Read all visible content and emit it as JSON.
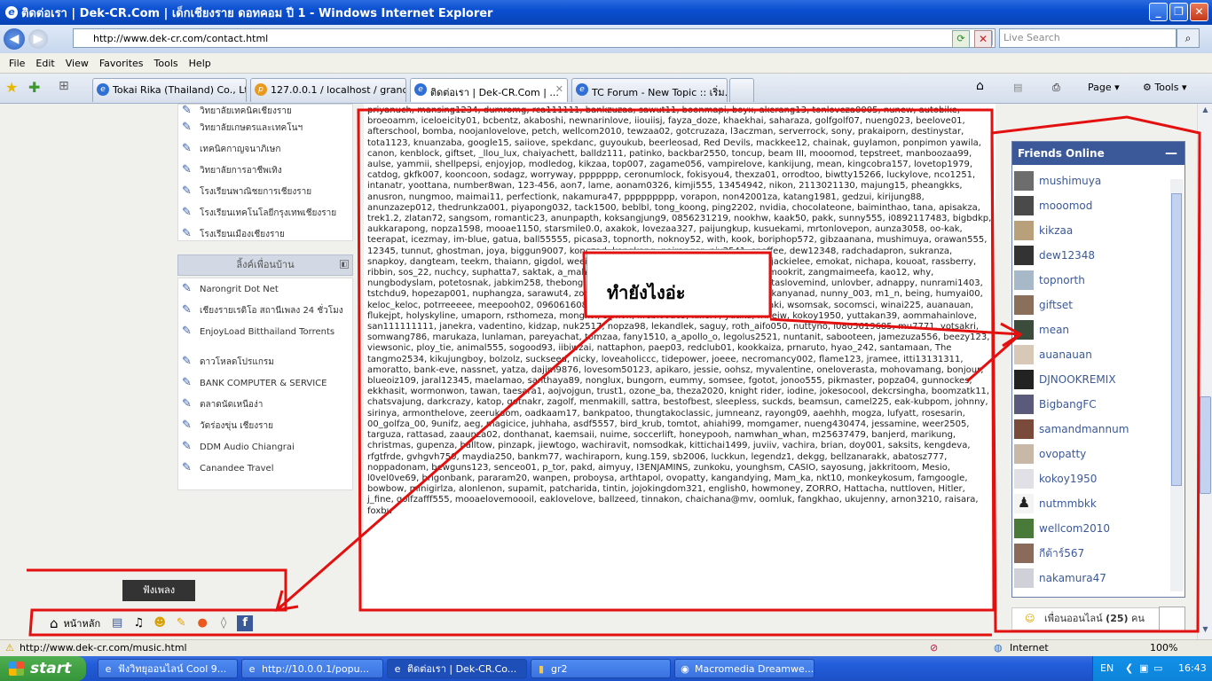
{
  "window": {
    "title": "ติดต่อเรา | Dek-CR.Com | เด็กเชียงราย ดอทคอม ปี 1 - Windows Internet Explorer"
  },
  "address": {
    "url": "http://www.dek-cr.com/contact.html",
    "search_placeholder": "Live Search"
  },
  "menu": [
    "File",
    "Edit",
    "View",
    "Favorites",
    "Tools",
    "Help"
  ],
  "tabs": [
    {
      "label": "Tokai Rika (Thailand) Co., Lt..."
    },
    {
      "label": "127.0.0.1 / localhost / grand..."
    },
    {
      "label": "ติดต่อเรา | Dek-CR.Com | ...",
      "active": true
    },
    {
      "label": "TC Forum - New Topic :: เริ่ม..."
    }
  ],
  "commands": {
    "page": "Page",
    "tools": "Tools"
  },
  "sidebar_top": [
    "วิทยาลัยเทคนิคเชียงราย",
    "วิทยาลัยเกษตรและเทคโนฯ",
    "เทคนิคกาญจนาภิเษก",
    "วิทยาลัยการอาชีพเทิง",
    "โรงเรียนพาณิชยการเชียงราย",
    "โรงเรียนเทคโนโลยีกรุงเทพเชียงราย",
    "โรงเรียนเมืองเชียงราย"
  ],
  "sidebar_heading": "ลิ้งค์เพื่อนบ้าน",
  "sidebar_links": [
    "Narongrit Dot Net",
    "เชียงรายเรดิโอ สถานีเพลง 24 ชั่วโมง",
    "EnjoyLoad Bitthailand Torrents",
    "ดาวโหลดโปรแกรม",
    "BANK COMPUTER & SERVICE",
    "ตลาดนัดเหนือง่า",
    "วัดร่องขุ่น เชียงราย",
    "DDM Audio Chiangrai",
    "Canandee Travel"
  ],
  "main_text": "priyanuch, mansing1234, dumromg, rca111111, bankzuzaa, sawut11, boonmapi, boyx, akerang13, tonloveza0005, nunew, autobike, broeoamm, iceloeicity01, bcbentz, akaboshi, newnarinlove, iiouiisj, fayza_doze, khaekhai, saharaza, golfgolf07, nueng023, beelove01, afterschool, bomba, noojanlovelove, petch, wellcom2010, tewzaa02, gotcruzaza, l3aczman, serverrock, sony, prakaiporn, destinystar, tota1123, knuanzaba, google15, saiiove, spekdanc, guyoukub, beerleosad, Red Devils, mackkee12, chainak, guylamon, ponpimon yawila, canon, kenblock, giftset, _llou_lux, chaiyachett, balldz111, patinko, backbar2550, toncup, beam III, mooomod, tepstreet, manboozaa99, aulse, yammii, shellpepsi, enjoyjop, modledog, kikzaa, top007, zagame056, vampirelove, kankijung, mean, kingcobra157, lovetop1979, catdog, gkfk007, kooncoon, sodagz, worryway, ppppppp, ceronumlock, fokisyou4, thexza01, orrodtoo, biwtty15266, luckylove, nco1251, intanatr, yoottana, number8wan, 123-456, aon7, lame, aonam0326, kimji555, 13454942, nikon, 2113021130, majung15, pheangkks, anusron, nungmoo, maimai11, perfectionk, nakamura47, ppppppppp, vorapon, non42001za, katang1981, gedzui, kirijung88, anunzazep012, thedrunkza001, piyapong032, tack1500, beblbl, tong_koong, ping2202, nvidia, chocolateone, baiminthao, tana, apisakza, trek1.2, zlatan72, sangsom, romantic23, anunpapth, koksangjung9, 0856231219, nookhw, kaak50, pakk, sunny555, i0892117483, bigbdkp, aukkarapong, nopza1598, mooae1150, starsmile0.0, axakok, lovezaa327, paijungkup, kusuekami, mrtonlovepon, aunza3058, oo-kak, teerapat, icezmay, im-blue, gatua, ball55555, picasa3, topnorth, noknoy52, with, kook, boriphop572, gibzaanana, mushimuya, orawan555, 12345, tunnut, ghostman, joya, biggun9007, kongzad, kongkong, nairanger, niy2541, snoffee, dew12348, radchadapron, sukranza, snapkoy, dangteam, teekm, thaiann, gigdol, weeix, boydmp, jame9090, crazie001, tap12, jackielee, emokat, nichapa, kouoat, rassberry, ribbin, sos_22, nuchcy, suphatta7, saktak, a_mahome, chamnan, bantiu, pool, tagyam01, mookrit, zangmaimeefa, kao12, why, nungbodyslam, potetosnak, jabkim258, thebong, beesandee, sodato, babytai69, namded, taslovemind, unlovber, adnappy, nunrami1403, tstchdu9, hopezap001, nuphangza, sarawut4, zombie, pt7990023, laslaly22, daveza5008, kanyanad, nunny_003, m1_n, being, humyai00, keloc_keloc, potrreeeee, meepooh02, 096061608, pou ka, qbic, thebat12561, finch, karudaki, wsomsak, socomsci, winai225, auanauan, flukejpt, holyskyline, umaporn, rsthomeza, mongkol, s_mon, lifebloodc3, killer7, yutika, mheiw, kokoy1950, yuttakan39, aommahainlove, san111111111, janekra, vadentino, kidzap, nuk2517, nopza98, lekandlek, saguy, roth_aifo050, nuttyno, i0805619685, mu7771, yotsakri, somwang786, marukaza, lunlaman, pareyachat, tomzaa, fany1510, a_apollo_o, legolus2521, nuntanit, sabooteen, jamezuza556, beezy123, viewsonic, ploy_tie, animal555, sogood93, iibiwzai, nattaphon, paep03, redclub01, kookkaiza, prnaruto, hyao_242, santamaan, The tangmo2534, kikujungboy, bolzolz, suckseed, nicky, loveaholiccc, tidepower, joeee, necromancy002, flame123, jramee, itti13131311, amoratto, bank-eve, nassnet, yatza, dajim9876, lovesom50123, apikaro, jessie, oohsz, myvalentine, oneloverasta, mohovamang, bonjour, blueoiz109, jaral12345, maelamao, santhaya89, nonglux, bungorn, eummy, somsee, fgotot, jonoo555, pikmaster, popza04, gunnockes, ekkhasit, wormonwon, tawan, taesara1, aojvojgun, trust1, ozone_ba, theza2020, knight rider, iodine, jokesocool, dekcrsingha, boomzatk11, chatsvajung, darkcrazy, katop, gotnakr, zagolf, menmakill, sattra, bestofbest, sleepless, suckds, beamsun, camel225, eak-kubpom, johnny, sirinya, armonthelove, zeerukaom, oadkaam17, bankpatoo, thungtakoclassic, jumneanz, rayong09, aaehhh, mogza, lufyatt, rosesarin, 00_golfza_00, 9unifz, aeg, magicice, juhhaha, asdf5557, bird_krub, tomtot, ahiahi99, momgamer, nueng430474, jessamine, weer2505, targuza, rattasad, zaaunza02, donthanat, kaemsaii, nuime, soccerlift, honeypooh, namwhan_whan, m25637479, banjerd, marikung, christmas, gupenza, balltow, pinzapk, jiewtogo, wachiravit, nomsodkak, kittichai1499, juviiv, vachira, brian, doy001, saksits, kengdeva, rfgtfrde, gvhgvh750, maydia250, bankm77, wachiraporn, kung.159, sb2006, luckkun, legendz1, dekgg, bellzanarakk, abatosz777, noppadonam, bewguns123, senceo01, p_tor, pakd, aimyuy, I3ENJAMINS, zunkoku, younghsm, CASIO, sayosung, jakkritoom, Mesio, l0vel0ve69, brigonbank, pararam20, wanpen, proboysa, arthtapol, ovopatty, kangandying, Mam_ka, nkt10, monkeykosum, famgoogle, bowbow, minigirlza, alonlenon, supamit, patcharida, tintin, jojokingdom321, english0, howmoney, ZORRO, Hattacha, nuttloven, Hitler, j_fine, golfzafff555, mooaelovemoooil, eaklovelove, ballzeed, tinnakon, chaichana@mv, oomluk, fangkhao, ukujenny, arnon3210, raisara, foxbu",
  "popup": {
    "text": "ทำยังไงอ่ะ"
  },
  "friends_online": {
    "title": "Friends Online",
    "items": [
      "mushimuya",
      "mooomod",
      "kikzaa",
      "dew12348",
      "topnorth",
      "giftset",
      "mean",
      "auanauan",
      "DJNOOKREMIX",
      "BigbangFC",
      "samandmannum",
      "ovopatty",
      "kokoy1950",
      "nutmmbkk",
      "wellcom2010",
      "กีต้าร์567",
      "nakamura47"
    ],
    "footer_label": "เพื่อนออนไลน์",
    "footer_count": "(25)",
    "footer_unit": "คน"
  },
  "bottom_bar": {
    "home_label": "หน้าหลัก",
    "tooltip": "ฟังเพลง"
  },
  "statusbar": {
    "url": "http://www.dek-cr.com/music.html",
    "zone": "Internet",
    "zoom": "100%"
  },
  "taskbar": {
    "start": "start",
    "items": [
      "ฟังวิทยุออนไลน์ Cool 9...",
      "http://10.0.0.1/popu...",
      "ติดต่อเรา | Dek-CR.Co...",
      "gr2",
      "Macromedia Dreamwe..."
    ],
    "lang": "EN",
    "time": "16:43"
  },
  "colors": {
    "annotation": "#e31010",
    "fb_blue": "#3b5998",
    "title_blue": "#0a4fd1"
  }
}
